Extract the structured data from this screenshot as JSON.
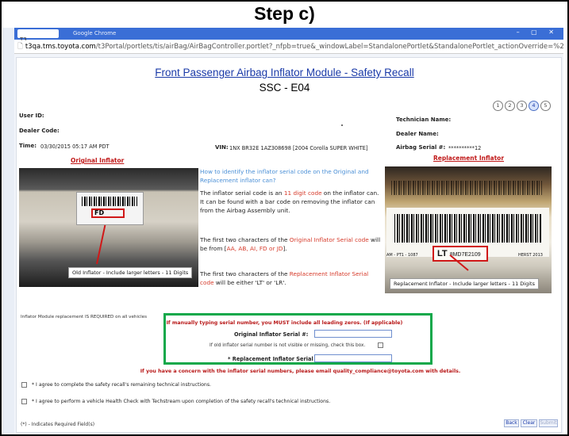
{
  "step_title": "Step c)",
  "browser": {
    "tab_label": "T3",
    "app_title": "Google Chrome",
    "window_controls": "– ▢ ✕",
    "url_host": "t3qa.tms.toyota.com",
    "url_path": "/t3Portal/portlets/tis/airBag/AirBagController.portlet?_nfpb=true&_windowLabel=StandalonePortlet&StandalonePortlet_actionOverride=%2Fportlets%2Ftis%2F"
  },
  "header": {
    "title": "Front Passenger Airbag Inflator Module - Safety Recall",
    "subtitle": "SSC - E04",
    "steps": [
      "1",
      "2",
      "3",
      "4",
      "5"
    ],
    "active_step": 4
  },
  "left_info": {
    "user_id_label": "User ID:",
    "dealer_code_label": "Dealer Code:",
    "time_label": "Time:",
    "time_value": "03/30/2015 05:17 AM PDT",
    "vin_label": "VIN:",
    "vin_value": "1NX BR32E 1AZ308698 [2004 Corolla SUPER WHITE]"
  },
  "right_info": {
    "technician_label": "Technician Name:",
    "dealer_name_label": "Dealer Name:",
    "airbag_serial_label": "Airbag Serial #:",
    "airbag_serial_value": "**********12"
  },
  "original_inflator": {
    "link": "Original Inflator",
    "caption": "Old Inflator - Include larger letters - 11 Digits",
    "code_fragment": "FD"
  },
  "replacement_inflator": {
    "link": "Replacement Inflator",
    "caption": "Replacement Inflator - Include larger letters - 11 Digits",
    "code_prefix": "LT",
    "code_rest": "8MD7E2109",
    "left_code": "AM - PT1 - 1087",
    "right_code": "HERST 2013"
  },
  "instructions": {
    "question": "How to identify the inflator serial code on the Original and Replacement inflator can?",
    "p1_a": "The inflator serial code is an ",
    "p1_highlight": "11 digit code",
    "p1_b": " on the inflator can. It can be found with a bar code on removing the inflator can from the Airbag Assembly unit.",
    "p2_a": "The first two characters of the ",
    "p2_highlight": "Original Inflator Serial code",
    "p2_b": " will be from [",
    "p2_codes": "AA, AB, AI, FD or JD",
    "p2_c": "].",
    "p3_a": "The first two characters of the ",
    "p3_highlight": "Replacement Inflator Serial code",
    "p3_b": " will be either 'LT' or 'LR'."
  },
  "form": {
    "required_note": "Inflator Module replacement IS REQUIRED on all vehicles",
    "warning": "If manually typing serial number, you MUST include all leading zeros. (If applicable)",
    "original_serial_label": "Original Inflator Serial #:",
    "original_serial_value": "",
    "missing_note": "If old inflator serial number is not visible or missing, check this box.",
    "replacement_serial_label": "* Replacement Inflator Serial #:",
    "replacement_serial_value": "",
    "concern": "If you have a concern with the inflator serial numbers, please email quality_compliance@toyota.com with details.",
    "agree1": "* I agree to complete the safety recall's remaining technical instructions.",
    "agree2": "* I agree to perform a vehicle Health Check with Techstream upon completion of the safety recall's technical instructions.",
    "required_fields": "(*) - Indicates Required Field(s)"
  },
  "buttons": {
    "back": "Back",
    "clear": "Clear",
    "submit": "Submit"
  },
  "colors": {
    "title_blue": "#1a3aa8",
    "highlight_red": "#d63a2a",
    "green_box": "#10a84a",
    "warning_red": "#b81818"
  }
}
